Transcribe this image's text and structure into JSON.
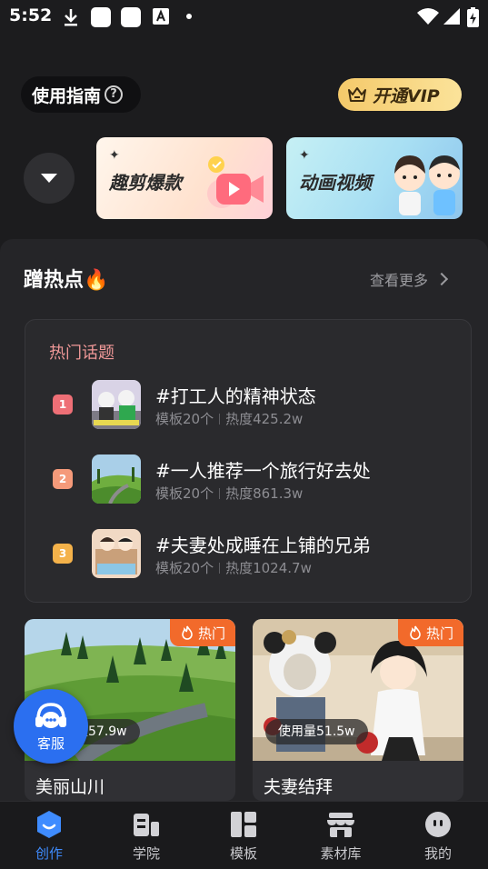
{
  "status_bar": {
    "time": "5:52"
  },
  "header": {
    "guide_label": "使用指南",
    "guide_help": "?",
    "vip_label": "开通VIP"
  },
  "banners": [
    {
      "title": "趣剪爆款"
    },
    {
      "title": "动画视频"
    }
  ],
  "hot": {
    "title": "蹭热点🔥",
    "see_more": "查看更多",
    "topics_title": "热门话题",
    "topics": [
      {
        "rank": "1",
        "name": "#打工人的精神状态",
        "templates": "模板20个",
        "heat": "热度425.2w",
        "rank_color": "#ee6f76"
      },
      {
        "rank": "2",
        "name": "#一人推荐一个旅行好去处",
        "templates": "模板20个",
        "heat": "热度861.3w",
        "rank_color": "#f59a7a"
      },
      {
        "rank": "3",
        "name": "#夫妻处成睡在上铺的兄弟",
        "templates": "模板20个",
        "heat": "热度1024.7w",
        "rank_color": "#f4b24a"
      }
    ]
  },
  "cards": [
    {
      "badge": "热门",
      "usage": "使用量57.9w",
      "title": "美丽山川"
    },
    {
      "badge": "热门",
      "usage": "使用量51.5w",
      "title": "夫妻结拜"
    }
  ],
  "service": {
    "label": "客服"
  },
  "tabs": [
    {
      "label": "创作",
      "icon": "create-icon",
      "active": true
    },
    {
      "label": "学院",
      "icon": "academy-icon",
      "active": false
    },
    {
      "label": "模板",
      "icon": "template-icon",
      "active": false
    },
    {
      "label": "素材库",
      "icon": "store-icon",
      "active": false
    },
    {
      "label": "我的",
      "icon": "profile-icon",
      "active": false
    }
  ],
  "colors": {
    "accent": "#3f8cff",
    "hot_badge": "#f26a2b",
    "vip_gold": "#f4c96a",
    "service_blue": "#2b6ff0"
  }
}
